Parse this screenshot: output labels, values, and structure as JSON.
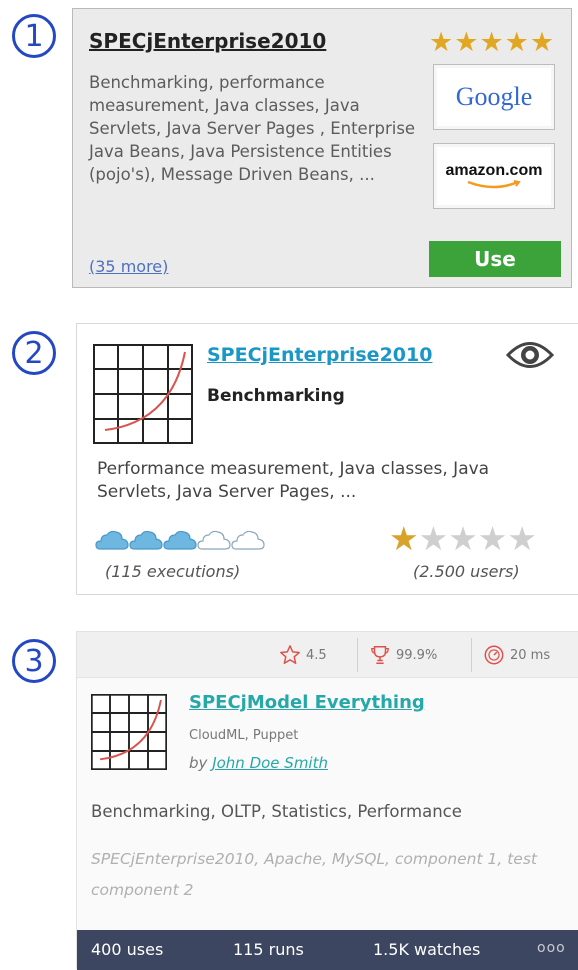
{
  "markers": [
    "1",
    "2",
    "3"
  ],
  "card1": {
    "title": "SPECjEnterprise2010",
    "rating": 5,
    "stars": [
      "★",
      "★",
      "★",
      "★",
      "★"
    ],
    "description": "Benchmarking, performance measurement, Java classes, Java Servlets, Java Server Pages , Enterprise Java Beans, Java Persistence Entities (pojo's), Message Driven Beans, ...",
    "google_label": "Google",
    "amazon_label": "amazon.com",
    "more_link": "(35 more)",
    "use_label": "Use",
    "colors": {
      "star": "#e2a722",
      "use_button": "#3ca33a"
    }
  },
  "card2": {
    "title": "SPECjEnterprise2010",
    "subtitle": "Benchmarking",
    "description": "Performance measurement, Java classes, Java Servlets, Java Server Pages, ...",
    "clouds_filled": 3,
    "clouds_total": 5,
    "executions": "(115 executions)",
    "rating": 1,
    "rating_max": 5,
    "stars": [
      "★",
      "★",
      "★",
      "★",
      "★"
    ],
    "users": "(2.500 users)",
    "icon": "eye-icon",
    "colors": {
      "title": "#1b97c7",
      "cloud": "#6db7e0",
      "star_on": "#d9a228",
      "star_off": "#cfcfcf"
    }
  },
  "card3": {
    "stats": {
      "rating": "4.5",
      "success": "99.9%",
      "time": "20 ms"
    },
    "title": "SPECjModel Everything",
    "tools": "CloudML, Puppet",
    "by_prefix": "by",
    "author": "John Doe Smith",
    "tags": "Benchmarking, OLTP, Statistics, Performance",
    "components": "SPECjEnterprise2010, Apache, MySQL, component 1, test component 2",
    "footer": {
      "uses": "400 uses",
      "runs": "115 runs",
      "watches": "1.5K watches",
      "more": "ooo"
    },
    "colors": {
      "title": "#27a8a8",
      "icons": "#e0504a",
      "footer_bg": "#3d4660"
    }
  }
}
